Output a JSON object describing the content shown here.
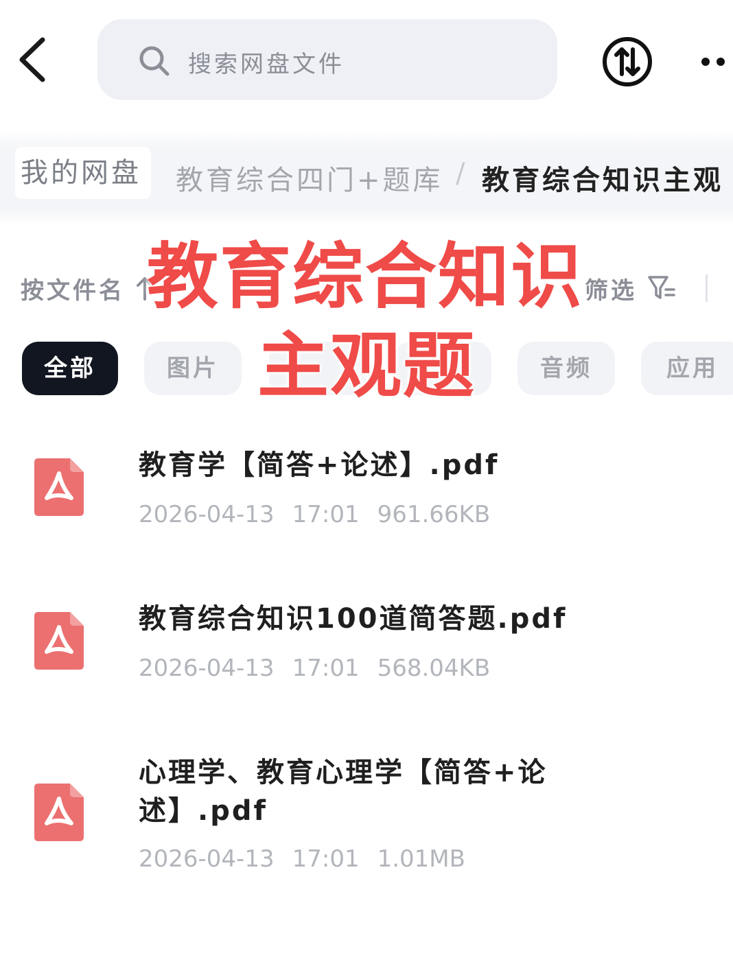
{
  "search": {
    "placeholder": "搜索网盘文件"
  },
  "breadcrumb": {
    "root": "我的网盘",
    "middle": "教育综合四门+题库",
    "separator": "/",
    "current": "教育综合知识主观"
  },
  "toolbar": {
    "sort_label": "按文件名",
    "filter_label": "筛选"
  },
  "categories": [
    {
      "label": "全部",
      "active": true
    },
    {
      "label": "图片",
      "active": false
    },
    {
      "label": "",
      "active": false
    },
    {
      "label": "",
      "active": false
    },
    {
      "label": "音频",
      "active": false
    },
    {
      "label": "应用",
      "active": false
    }
  ],
  "overlay": {
    "line1": "教育综合知识",
    "line2": "主观题",
    "color": "#ef4b48"
  },
  "files": [
    {
      "name": "教育学【简答+论述】.pdf",
      "date": "2026-04-13",
      "time": "17:01",
      "size": "961.66KB",
      "icon": "pdf-file-icon"
    },
    {
      "name": "教育综合知识100道简答题.pdf",
      "date": "2026-04-13",
      "time": "17:01",
      "size": "568.04KB",
      "icon": "pdf-file-icon"
    },
    {
      "name": "心理学、教育心理学【简答+论述】.pdf",
      "date": "2026-04-13",
      "time": "17:01",
      "size": "1.01MB",
      "icon": "pdf-file-icon"
    }
  ],
  "colors": {
    "pdf_icon": "#ec7070",
    "active_chip": "#121620",
    "search_bg": "#eef0f5"
  }
}
